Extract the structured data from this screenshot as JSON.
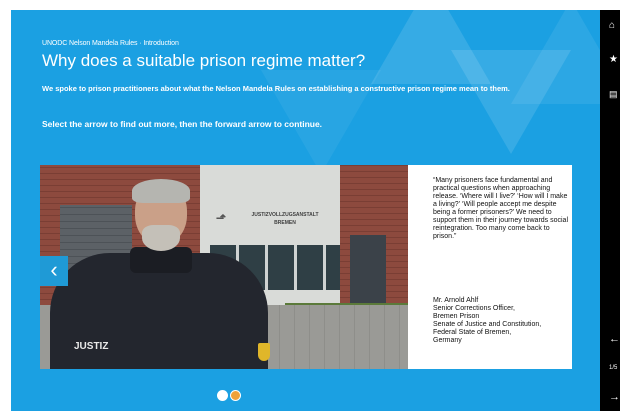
{
  "course_label": "UNODC Nelson Mandela Rules · Introduction",
  "page_title": "Why does a suitable prison regime matter?",
  "intro_text": "We spoke to prison practitioners about what the Nelson Mandela Rules on establishing a constructive prison regime mean to them.",
  "instruction_text": "Select the arrow to find out more, then the forward arrow to continue.",
  "slide": {
    "building_sign_line1": "JUSTIZVOLLZUGSANSTALT",
    "building_sign_line2": "BREMEN",
    "uniform_text": "JUSTIZ",
    "quote": "“Many prisoners face fundamental and practical questions when approaching release. ‘Where will I live?’ ‘How will I make a living?’ ‘Will people accept me despite being a former prisoners?’ We need to support them in their journey towards social reintegration. Too many come back to prison.”",
    "author_lines": [
      "Mr. Arnold Ahlf",
      "Senior Corrections Officer,",
      "Bremen Prison",
      "Senate of Justice and Constitution,",
      "Federal State of Bremen,",
      "Germany"
    ]
  },
  "prev_arrow_glyph": "‹",
  "carousel": {
    "total": 2,
    "active_index": 1,
    "active_color": "#f0a23a",
    "inactive_color": "#ffffff"
  },
  "nav_rail": {
    "home_icon": "⌂",
    "star_icon": "★",
    "doc_icon": "▤",
    "back_icon": "←",
    "page_indicator": "1/5",
    "next_icon": "→"
  },
  "colors": {
    "stage_blue": "#1ba0e2",
    "rail_black": "#000000"
  }
}
